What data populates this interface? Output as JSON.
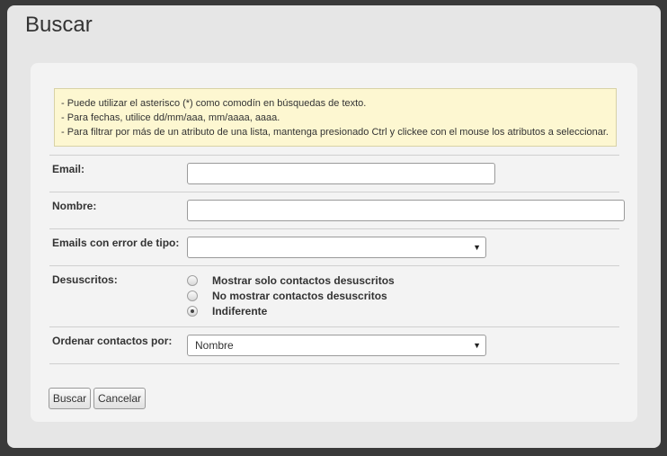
{
  "page": {
    "title": "Buscar"
  },
  "hints": [
    "- Puede utilizar el asterisco (*) como comodín en búsquedas de texto.",
    "- Para fechas, utilice dd/mm/aaa, mm/aaaa, aaaa.",
    "- Para filtrar por más de un atributo de una lista, mantenga presionado Ctrl y clickee con el mouse los atributos a seleccionar."
  ],
  "form": {
    "email": {
      "label": "Email:",
      "value": ""
    },
    "nombre": {
      "label": "Nombre:",
      "value": ""
    },
    "email_error": {
      "label": "Emails con error de tipo:",
      "selected": ""
    },
    "desuscritos": {
      "label": "Desuscritos:",
      "options": [
        {
          "label": "Mostrar solo contactos desuscritos",
          "checked": false
        },
        {
          "label": "No mostrar contactos desuscritos",
          "checked": false
        },
        {
          "label": "Indiferente",
          "checked": true
        }
      ]
    },
    "orden": {
      "label": "Ordenar contactos por:",
      "selected": "Nombre"
    }
  },
  "actions": {
    "search_label": "Buscar",
    "cancel_label": "Cancelar"
  }
}
